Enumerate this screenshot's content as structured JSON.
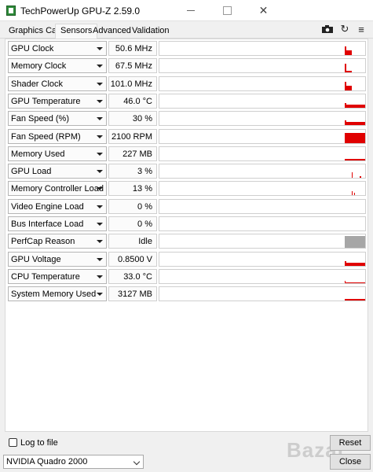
{
  "window": {
    "title": "TechPowerUp GPU-Z 2.59.0",
    "close_glyph": "✕"
  },
  "tabs": [
    {
      "label": "Graphics Card"
    },
    {
      "label": "Sensors"
    },
    {
      "label": "Advanced"
    },
    {
      "label": "Validation"
    }
  ],
  "toolbar": {
    "camera_icon": "camera-icon",
    "refresh_icon": "refresh-icon",
    "menu_icon": "hamburger-menu-icon",
    "refresh_glyph": "↻",
    "menu_glyph": "≡"
  },
  "sensors": [
    {
      "name": "GPU Clock",
      "value": "50.6 MHz",
      "graph": "clock-spike"
    },
    {
      "name": "Memory Clock",
      "value": "67.5 MHz",
      "graph": "clock-step"
    },
    {
      "name": "Shader Clock",
      "value": "101.0 MHz",
      "graph": "clock-spike"
    },
    {
      "name": "GPU Temperature",
      "value": "46.0 °C",
      "graph": "flat-high"
    },
    {
      "name": "Fan Speed (%)",
      "value": "30 %",
      "graph": "flat-high"
    },
    {
      "name": "Fan Speed (RPM)",
      "value": "2100 RPM",
      "graph": "block-full"
    },
    {
      "name": "Memory Used",
      "value": "227 MB",
      "graph": "flat-mid"
    },
    {
      "name": "GPU Load",
      "value": "3 %",
      "graph": "tiny-spikes"
    },
    {
      "name": "Memory Controller Load",
      "value": "13 %",
      "graph": "small-spike"
    },
    {
      "name": "Video Engine Load",
      "value": "0 %",
      "graph": "none"
    },
    {
      "name": "Bus Interface Load",
      "value": "0 %",
      "graph": "none"
    },
    {
      "name": "PerfCap Reason",
      "value": "Idle",
      "graph": "gray-block"
    },
    {
      "name": "GPU Voltage",
      "value": "0.8500 V",
      "graph": "flat-high"
    },
    {
      "name": "CPU Temperature",
      "value": "33.0 °C",
      "graph": "flat-low"
    },
    {
      "name": "System Memory Used",
      "value": "3127 MB",
      "graph": "flat-mid"
    }
  ],
  "footer": {
    "log_label": "Log to file",
    "log_checked": false,
    "reset_label": "Reset",
    "device": "NVIDIA Quadro 2000",
    "close_label": "Close"
  },
  "watermark": "Bazar",
  "colors": {
    "graph_red": "#e00000",
    "perfcap_gray": "#a6a6a6"
  }
}
